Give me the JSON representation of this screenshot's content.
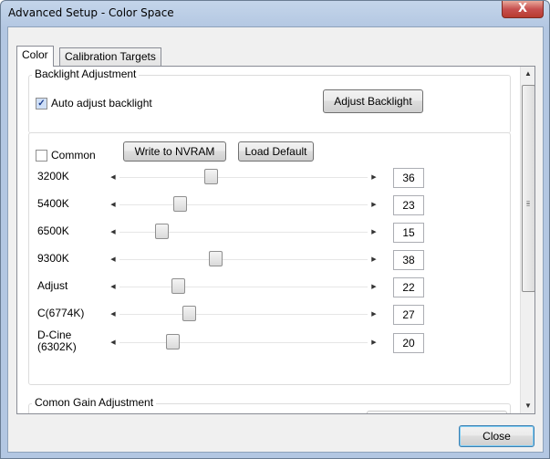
{
  "window": {
    "title": "Advanced Setup - Color Space",
    "close_glyph": "X"
  },
  "tabs": [
    {
      "label": "Color",
      "active": true
    },
    {
      "label": "Calibration Targets",
      "active": false
    }
  ],
  "backlight": {
    "legend": "Backlight Adjustment",
    "auto_checkbox_label": "Auto adjust backlight",
    "auto_checked": true,
    "adjust_button": "Adjust Backlight"
  },
  "temps": {
    "common_checkbox_label": "Common",
    "common_checked": false,
    "write_button": "Write to NVRAM",
    "load_button": "Load Default",
    "sliders": [
      {
        "label": "3200K",
        "value": "36",
        "level": 36
      },
      {
        "label": "5400K",
        "value": "23",
        "level": 23
      },
      {
        "label": "6500K",
        "value": "15",
        "level": 15
      },
      {
        "label": "9300K",
        "value": "38",
        "level": 38
      },
      {
        "label": "Adjust",
        "value": "22",
        "level": 22
      },
      {
        "label": "C(6774K)",
        "value": "27",
        "level": 27
      },
      {
        "label": "D-Cine\n(6302K)",
        "value": "20",
        "level": 20
      }
    ],
    "slider_max": 100
  },
  "gain": {
    "legend": "Comon Gain Adjustment"
  },
  "footer": {
    "close_button": "Close"
  }
}
